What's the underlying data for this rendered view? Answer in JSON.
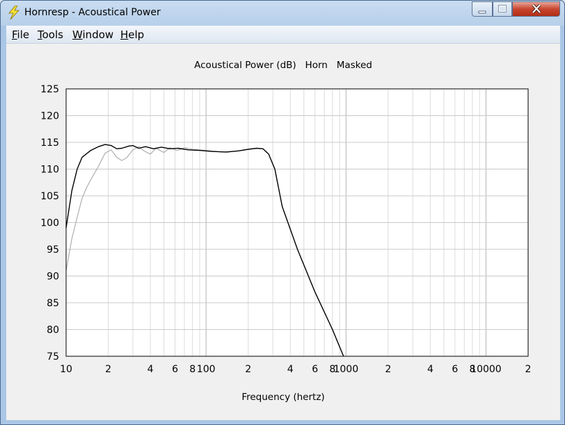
{
  "window": {
    "title": "Hornresp - Acoustical Power"
  },
  "menu": [
    {
      "label": "File",
      "accel": "F",
      "rest": "ile"
    },
    {
      "label": "Tools",
      "accel": "T",
      "rest": "ools"
    },
    {
      "label": "Window",
      "accel": "W",
      "rest": "indow"
    },
    {
      "label": "Help",
      "accel": "H",
      "rest": "elp"
    }
  ],
  "chart_data": {
    "type": "line",
    "title": "Acoustical Power (dB)   Horn   Masked",
    "xlabel": "Frequency (hertz)",
    "ylabel": "",
    "xscale": "log",
    "xlim": [
      10,
      20000
    ],
    "ylim": [
      75,
      125
    ],
    "yticks": [
      75,
      80,
      85,
      90,
      95,
      100,
      105,
      110,
      115,
      120,
      125
    ],
    "xtick_labels": [
      {
        "value": 10,
        "label": "10"
      },
      {
        "value": 20,
        "label": "2"
      },
      {
        "value": 40,
        "label": "4"
      },
      {
        "value": 60,
        "label": "6"
      },
      {
        "value": 80,
        "label": "8"
      },
      {
        "value": 100,
        "label": "100"
      },
      {
        "value": 200,
        "label": "2"
      },
      {
        "value": 400,
        "label": "4"
      },
      {
        "value": 600,
        "label": "6"
      },
      {
        "value": 800,
        "label": "8"
      },
      {
        "value": 1000,
        "label": "1000"
      },
      {
        "value": 2000,
        "label": "2"
      },
      {
        "value": 4000,
        "label": "4"
      },
      {
        "value": 6000,
        "label": "6"
      },
      {
        "value": 8000,
        "label": "8"
      },
      {
        "value": 10000,
        "label": "10000"
      },
      {
        "value": 20000,
        "label": "2"
      }
    ],
    "grid": true,
    "series": [
      {
        "color": "#000000",
        "points": [
          [
            10,
            99
          ],
          [
            11,
            106
          ],
          [
            12,
            110
          ],
          [
            13,
            112.2
          ],
          [
            15,
            113.5
          ],
          [
            17,
            114.2
          ],
          [
            19,
            114.6
          ],
          [
            21,
            114.4
          ],
          [
            23,
            113.8
          ],
          [
            25,
            113.9
          ],
          [
            28,
            114.3
          ],
          [
            30,
            114.4
          ],
          [
            33,
            113.9
          ],
          [
            37,
            114.2
          ],
          [
            42,
            113.8
          ],
          [
            48,
            114.1
          ],
          [
            55,
            113.8
          ],
          [
            63,
            113.9
          ],
          [
            75,
            113.6
          ],
          [
            90,
            113.5
          ],
          [
            110,
            113.3
          ],
          [
            140,
            113.2
          ],
          [
            170,
            113.4
          ],
          [
            200,
            113.7
          ],
          [
            230,
            113.9
          ],
          [
            255,
            113.8
          ],
          [
            280,
            112.8
          ],
          [
            310,
            110
          ],
          [
            350,
            103
          ],
          [
            450,
            95
          ],
          [
            600,
            87
          ],
          [
            800,
            80
          ],
          [
            960,
            75
          ]
        ]
      },
      {
        "color": "#a8a8a8",
        "points": [
          [
            10,
            91
          ],
          [
            11,
            97
          ],
          [
            12,
            101
          ],
          [
            13,
            104.5
          ],
          [
            14,
            106.5
          ],
          [
            15,
            108
          ],
          [
            17,
            110.5
          ],
          [
            19,
            113
          ],
          [
            21,
            113.6
          ],
          [
            23,
            112.2
          ],
          [
            25,
            111.6
          ],
          [
            27,
            112.1
          ],
          [
            30,
            113.6
          ],
          [
            33,
            114.2
          ],
          [
            36,
            113.4
          ],
          [
            40,
            112.8
          ],
          [
            44,
            113.9
          ],
          [
            50,
            113.1
          ],
          [
            55,
            114
          ],
          [
            62,
            113.5
          ],
          [
            70,
            114
          ],
          [
            80,
            113.7
          ],
          [
            100,
            113.5
          ],
          [
            130,
            113.2
          ],
          [
            170,
            113.4
          ],
          [
            200,
            113.7
          ],
          [
            230,
            113.9
          ],
          [
            255,
            113.8
          ],
          [
            280,
            112.8
          ],
          [
            310,
            110
          ],
          [
            350,
            103
          ],
          [
            450,
            95
          ],
          [
            600,
            87
          ],
          [
            800,
            80
          ],
          [
            960,
            75
          ]
        ]
      }
    ]
  }
}
